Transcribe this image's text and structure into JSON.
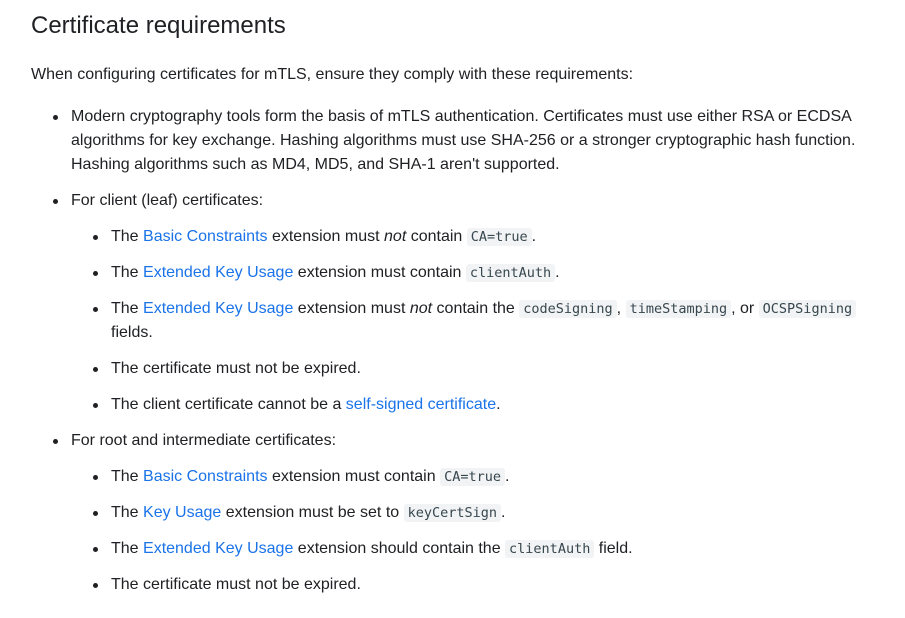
{
  "title": "Certificate requirements",
  "intro": "When configuring certificates for mTLS, ensure they comply with these requirements:",
  "item1": "Modern cryptography tools form the basis of mTLS authentication. Certificates must use either RSA or ECDSA algorithms for key exchange. Hashing algorithms must use SHA-256 or a stronger cryptographic hash function. Hashing algorithms such as MD4, MD5, and SHA-1 aren't supported.",
  "client": {
    "heading": "For client (leaf) certificates:",
    "r1": {
      "pre": "The ",
      "link": "Basic Constraints",
      "mid": " extension must ",
      "em": "not",
      "post": " contain ",
      "code": "CA=true",
      "end": "."
    },
    "r2": {
      "pre": "The ",
      "link": "Extended Key Usage",
      "mid": " extension must contain ",
      "code": "clientAuth",
      "end": "."
    },
    "r3": {
      "pre": "The ",
      "link": "Extended Key Usage",
      "mid": " extension must ",
      "em": "not",
      "post": " contain the ",
      "code1": "codeSigning",
      "sep1": ", ",
      "code2": "timeStamping",
      "sep2": ", or ",
      "code3": "OCSPSigning",
      "end": " fields."
    },
    "r4": "The certificate must not be expired.",
    "r5": {
      "pre": "The client certificate cannot be a ",
      "link": "self-signed certificate",
      "end": "."
    }
  },
  "root": {
    "heading": "For root and intermediate certificates:",
    "r1": {
      "pre": "The ",
      "link": "Basic Constraints",
      "mid": " extension must contain ",
      "code": "CA=true",
      "end": "."
    },
    "r2": {
      "pre": "The ",
      "link": "Key Usage",
      "mid": " extension must be set to ",
      "code": "keyCertSign",
      "end": "."
    },
    "r3": {
      "pre": "The ",
      "link": "Extended Key Usage",
      "mid": " extension should contain the ",
      "code": "clientAuth",
      "end": " field."
    },
    "r4": "The certificate must not be expired."
  }
}
